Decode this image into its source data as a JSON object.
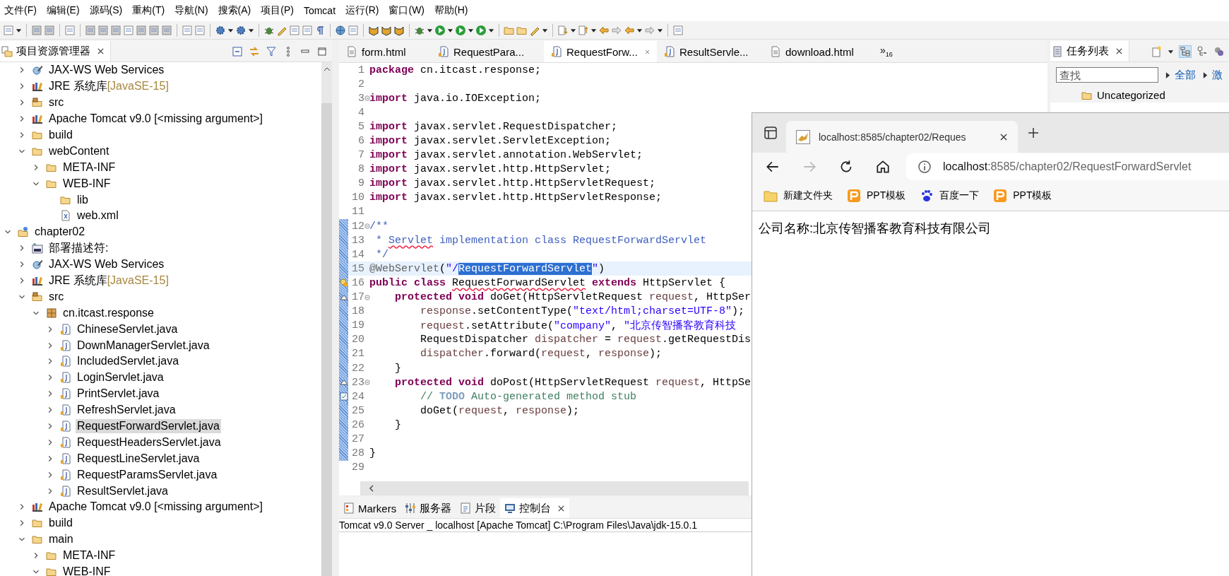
{
  "menu": [
    "文件(F)",
    "编辑(E)",
    "源码(S)",
    "重构(T)",
    "导航(N)",
    "搜索(A)",
    "项目(P)",
    "Tomcat",
    "运行(R)",
    "窗口(W)",
    "帮助(H)"
  ],
  "explorer": {
    "title": "项目资源管理器",
    "tree": [
      {
        "children": [
          {
            "label": "JAX-WS Web Services",
            "kind": "webservices",
            "expanded": false,
            "selected": false
          },
          {
            "label": "JRE 系统库",
            "decoration": "[JavaSE-15]",
            "kind": "library",
            "expanded": false,
            "selected": false
          },
          {
            "label": "src",
            "kind": "srcfolder",
            "expanded": false,
            "selected": false
          },
          {
            "label": "Apache Tomcat v9.0 [<missing argument>]",
            "kind": "library",
            "expanded": false,
            "selected": false
          },
          {
            "label": "build",
            "kind": "folder",
            "expanded": false,
            "selected": false
          },
          {
            "label": "webContent",
            "kind": "folder",
            "expanded": true,
            "selected": false,
            "children": [
              {
                "label": "META-INF",
                "kind": "folder",
                "expanded": false,
                "selected": false
              },
              {
                "label": "WEB-INF",
                "kind": "folder",
                "expanded": true,
                "selected": false,
                "children": [
                  {
                    "label": "lib",
                    "kind": "folder",
                    "selected": false
                  },
                  {
                    "label": "web.xml",
                    "kind": "xml",
                    "selected": false
                  }
                ]
              }
            ]
          }
        ]
      },
      {
        "label": "chapter02",
        "kind": "project",
        "expanded": true,
        "selected": false,
        "children": [
          {
            "label": "部署描述符:",
            "kind": "deploy",
            "expanded": false,
            "selected": false
          },
          {
            "label": "JAX-WS Web Services",
            "kind": "webservices",
            "expanded": false,
            "selected": false
          },
          {
            "label": "JRE 系统库",
            "decoration": "[JavaSE-15]",
            "kind": "library",
            "expanded": false,
            "selected": false
          },
          {
            "label": "src",
            "kind": "srcfolder",
            "expanded": true,
            "selected": false,
            "children": [
              {
                "label": "cn.itcast.response",
                "kind": "package",
                "expanded": true,
                "selected": false,
                "children": [
                  {
                    "label": "ChineseServlet.java",
                    "kind": "java",
                    "expanded": false,
                    "selected": false
                  },
                  {
                    "label": "DownManagerServlet.java",
                    "kind": "java",
                    "expanded": false,
                    "selected": false
                  },
                  {
                    "label": "IncludedServlet.java",
                    "kind": "java",
                    "expanded": false,
                    "selected": false
                  },
                  {
                    "label": "LoginServlet.java",
                    "kind": "java",
                    "expanded": false,
                    "selected": false
                  },
                  {
                    "label": "PrintServlet.java",
                    "kind": "java",
                    "expanded": false,
                    "selected": false
                  },
                  {
                    "label": "RefreshServlet.java",
                    "kind": "java",
                    "expanded": false,
                    "selected": false
                  },
                  {
                    "label": "RequestForwardServlet.java",
                    "kind": "java",
                    "expanded": false,
                    "selected": true
                  },
                  {
                    "label": "RequestHeadersServlet.java",
                    "kind": "java",
                    "expanded": false,
                    "selected": false
                  },
                  {
                    "label": "RequestLineServlet.java",
                    "kind": "java",
                    "expanded": false,
                    "selected": false
                  },
                  {
                    "label": "RequestParamsServlet.java",
                    "kind": "java",
                    "expanded": false,
                    "selected": false
                  },
                  {
                    "label": "ResultServlet.java",
                    "kind": "java",
                    "expanded": false,
                    "selected": false
                  }
                ]
              }
            ]
          },
          {
            "label": "Apache Tomcat v9.0 [<missing argument>]",
            "kind": "library",
            "expanded": false,
            "selected": false
          },
          {
            "label": "build",
            "kind": "folder",
            "expanded": false,
            "selected": false
          },
          {
            "label": "main",
            "kind": "folder",
            "expanded": true,
            "selected": false,
            "children": [
              {
                "label": "META-INF",
                "kind": "folder",
                "expanded": false,
                "selected": false
              },
              {
                "label": "WEB-INF",
                "kind": "folder",
                "expanded": true,
                "selected": false
              }
            ]
          }
        ]
      }
    ]
  },
  "editor": {
    "tabs": [
      {
        "label": "form.html",
        "kind": "html",
        "selected": false
      },
      {
        "label": "RequestPara...",
        "kind": "java",
        "selected": false
      },
      {
        "label": "RequestForw...",
        "kind": "java",
        "selected": true
      },
      {
        "label": "ResultServle...",
        "kind": "java",
        "selected": false
      },
      {
        "label": "download.html",
        "kind": "html",
        "selected": false
      }
    ],
    "overflow": {
      "label": "»",
      "count": "16"
    },
    "lines": [
      {
        "number": "1",
        "segments": [
          {
            "text": "package",
            "kind": "kw"
          },
          {
            "text": " cn.itcast.response;",
            "kind": "plain"
          }
        ]
      },
      {
        "number": "2"
      },
      {
        "number": "3",
        "fold": true,
        "segments": [
          {
            "text": "import",
            "kind": "kw"
          },
          {
            "text": " java.io.IOException;",
            "kind": "plain"
          }
        ]
      },
      {
        "number": "4"
      },
      {
        "number": "5",
        "segments": [
          {
            "text": "import",
            "kind": "kw"
          },
          {
            "text": " javax.servlet.RequestDispatcher;",
            "kind": "plain"
          }
        ]
      },
      {
        "number": "6",
        "segments": [
          {
            "text": "import",
            "kind": "kw"
          },
          {
            "text": " javax.servlet.ServletException;",
            "kind": "plain"
          }
        ]
      },
      {
        "number": "7",
        "segments": [
          {
            "text": "import",
            "kind": "kw"
          },
          {
            "text": " javax.servlet.annotation.WebServlet;",
            "kind": "plain"
          }
        ]
      },
      {
        "number": "8",
        "segments": [
          {
            "text": "import",
            "kind": "kw"
          },
          {
            "text": " javax.servlet.http.HttpServlet;",
            "kind": "plain"
          }
        ]
      },
      {
        "number": "9",
        "segments": [
          {
            "text": "import",
            "kind": "kw"
          },
          {
            "text": " javax.servlet.http.HttpServletRequest;",
            "kind": "plain"
          }
        ]
      },
      {
        "number": "10",
        "segments": [
          {
            "text": "import",
            "kind": "kw"
          },
          {
            "text": " javax.servlet.http.HttpServletResponse;",
            "kind": "plain"
          }
        ]
      },
      {
        "number": "11"
      },
      {
        "number": "12",
        "fold": true,
        "changed": true,
        "segments": [
          {
            "text": "/**",
            "kind": "doc"
          }
        ]
      },
      {
        "number": "13",
        "changed": true,
        "segments": [
          {
            "text": " * ",
            "kind": "doc"
          },
          {
            "text": "Servlet",
            "kind": "doc",
            "misspelled": true
          },
          {
            "text": " implementation class RequestForwardServlet",
            "kind": "doc"
          }
        ]
      },
      {
        "number": "14",
        "changed": true,
        "segments": [
          {
            "text": " */",
            "kind": "doc"
          }
        ]
      },
      {
        "number": "15",
        "changed": true,
        "current": true,
        "segments": [
          {
            "text": "@WebServlet",
            "kind": "ann"
          },
          {
            "text": "(",
            "kind": "plain"
          },
          {
            "text": "\"/",
            "kind": "str"
          },
          {
            "text": "RequestForwardServlet",
            "kind": "selected"
          },
          {
            "text": "\"",
            "kind": "str"
          },
          {
            "text": ")",
            "kind": "plain"
          }
        ]
      },
      {
        "number": "16",
        "changed": true,
        "kind": "warning",
        "segments": [
          {
            "text": "public ",
            "kind": "kw"
          },
          {
            "text": "class ",
            "kind": "kw"
          },
          {
            "text": "RequestForwardServlet",
            "kind": "plain",
            "misspelled": true
          },
          {
            "text": " extends",
            "kind": "kw"
          },
          {
            "text": " HttpServlet {",
            "kind": "plain"
          }
        ]
      },
      {
        "number": "17",
        "changed": true,
        "fold": true,
        "kind": "override",
        "segments": [
          {
            "text": "    protected",
            "kind": "kw"
          },
          {
            "text": " void",
            "kind": "kw"
          },
          {
            "text": " doGet(HttpServletRequest ",
            "kind": "plain"
          },
          {
            "text": "request",
            "kind": "var"
          },
          {
            "text": ", HttpSer",
            "kind": "plain"
          }
        ]
      },
      {
        "number": "18",
        "changed": true,
        "segments": [
          {
            "text": "        response",
            "kind": "var"
          },
          {
            "text": ".setContentType(",
            "kind": "plain"
          },
          {
            "text": "\"text/html;charset=UTF-8\"",
            "kind": "str"
          },
          {
            "text": ");",
            "kind": "plain"
          }
        ]
      },
      {
        "number": "19",
        "changed": true,
        "segments": [
          {
            "text": "        request",
            "kind": "var"
          },
          {
            "text": ".setAttribute(",
            "kind": "plain"
          },
          {
            "text": "\"company\"",
            "kind": "str"
          },
          {
            "text": ", ",
            "kind": "plain"
          },
          {
            "text": "\"北京传智播客教育科技",
            "kind": "str"
          }
        ]
      },
      {
        "number": "20",
        "changed": true,
        "segments": [
          {
            "text": "        RequestDispatcher ",
            "kind": "plain"
          },
          {
            "text": "dispatcher",
            "kind": "var"
          },
          {
            "text": " = ",
            "kind": "plain"
          },
          {
            "text": "request",
            "kind": "var"
          },
          {
            "text": ".getRequestDis",
            "kind": "plain"
          }
        ]
      },
      {
        "number": "21",
        "changed": true,
        "segments": [
          {
            "text": "        dispatcher",
            "kind": "var"
          },
          {
            "text": ".forward(",
            "kind": "plain"
          },
          {
            "text": "request",
            "kind": "var"
          },
          {
            "text": ", ",
            "kind": "plain"
          },
          {
            "text": "response",
            "kind": "var"
          },
          {
            "text": ");",
            "kind": "plain"
          }
        ]
      },
      {
        "number": "22",
        "changed": true,
        "segments": [
          {
            "text": "    }",
            "kind": "plain"
          }
        ]
      },
      {
        "number": "23",
        "changed": true,
        "fold": true,
        "kind": "override",
        "segments": [
          {
            "text": "    protected",
            "kind": "kw"
          },
          {
            "text": " void",
            "kind": "kw"
          },
          {
            "text": " doPost(HttpServletRequest ",
            "kind": "plain"
          },
          {
            "text": "request",
            "kind": "var"
          },
          {
            "text": ", HttpSe",
            "kind": "plain"
          }
        ]
      },
      {
        "number": "24",
        "changed": true,
        "kind": "task",
        "segments": [
          {
            "text": "        // ",
            "kind": "cmt"
          },
          {
            "text": "TODO",
            "kind": "todo"
          },
          {
            "text": " Auto-generated method stub",
            "kind": "cmt"
          }
        ]
      },
      {
        "number": "25",
        "changed": true,
        "segments": [
          {
            "text": "        doGet(",
            "kind": "plain"
          },
          {
            "text": "request",
            "kind": "var"
          },
          {
            "text": ", ",
            "kind": "plain"
          },
          {
            "text": "response",
            "kind": "var"
          },
          {
            "text": ");",
            "kind": "plain"
          }
        ]
      },
      {
        "number": "26",
        "changed": true,
        "segments": [
          {
            "text": "    }",
            "kind": "plain"
          }
        ]
      },
      {
        "number": "27",
        "changed": true
      },
      {
        "number": "28",
        "changed": true,
        "segments": [
          {
            "text": "}",
            "kind": "plain"
          }
        ]
      },
      {
        "number": "29"
      }
    ]
  },
  "console": {
    "tabs": [
      {
        "label": "Markers",
        "kind": "markers",
        "selected": false
      },
      {
        "label": "服务器",
        "kind": "servers",
        "selected": false
      },
      {
        "label": "片段",
        "kind": "snippets",
        "selected": false
      },
      {
        "label": "控制台",
        "kind": "console",
        "selected": true
      }
    ],
    "header": "Tomcat v9.0 Server _ localhost [Apache Tomcat] C:\\Program Files\\Java\\jdk-15.0.1"
  },
  "tasks": {
    "title": "任务列表",
    "search": {
      "placeholder": "查找"
    },
    "links": [
      "全部",
      "激"
    ],
    "items": [
      "Uncategorized"
    ]
  },
  "browser": {
    "tab": {
      "title": "localhost:8585/chapter02/Reques"
    },
    "nav": [
      {
        "kind": "back",
        "disabled": false
      },
      {
        "kind": "forward",
        "disabled": true
      },
      {
        "kind": "reload",
        "disabled": false
      },
      {
        "kind": "home",
        "disabled": false
      }
    ],
    "address": {
      "host": "localhost",
      "path": ":8585/chapter02/RequestForwardServlet"
    },
    "bookmarks": [
      {
        "label": "新建文件夹",
        "kind": "folder"
      },
      {
        "label": "PPT模板",
        "kind": "p"
      },
      {
        "label": "百度一下",
        "kind": "paw"
      },
      {
        "label": "PPT模板",
        "kind": "p"
      }
    ],
    "content": "公司名称:北京传智播客教育科技有限公司"
  }
}
